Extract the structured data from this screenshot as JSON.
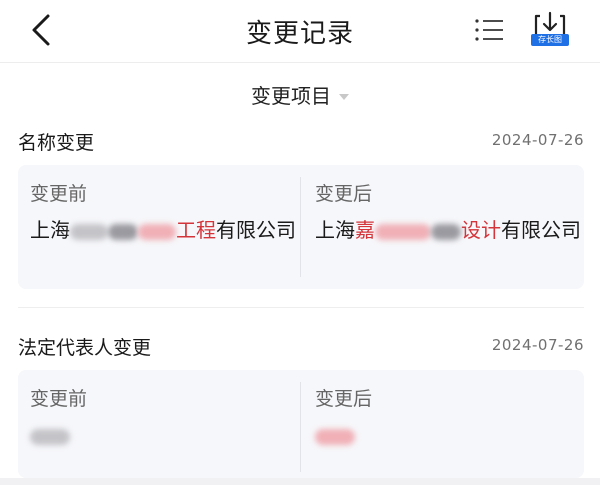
{
  "header": {
    "title": "变更记录",
    "back_icon": "chevron-left-icon",
    "menu_icon": "list-icon",
    "download_icon": "download-long-image-icon",
    "download_badge": "存长图",
    "accent_color": "#1f6fe5"
  },
  "filter": {
    "label": "变更项目"
  },
  "records": [
    {
      "name": "名称变更",
      "date": "2024-07-26",
      "before_label": "变更前",
      "before_prefix": "上海",
      "before_red": "工程",
      "before_suffix": "有限公司",
      "after_label": "变更后",
      "after_prefix": "上海",
      "after_red_1": "嘉",
      "after_red_2": "设计",
      "after_suffix": "有限公司"
    },
    {
      "name": "法定代表人变更",
      "date": "2024-07-26",
      "before_label": "变更前",
      "after_label": "变更后"
    }
  ],
  "colors": {
    "highlight_red": "#d4343a",
    "card_bg": "#f6f7fa"
  }
}
